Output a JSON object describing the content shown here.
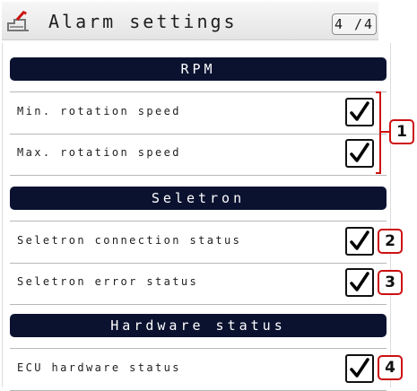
{
  "header": {
    "title": "Alarm settings",
    "page_indicator": "4 /4",
    "icon": "seeder-settings-icon"
  },
  "sections": [
    {
      "title": "RPM",
      "items": [
        {
          "label": "Min. rotation speed",
          "checked": true
        },
        {
          "label": "Max. rotation speed",
          "checked": true
        }
      ]
    },
    {
      "title": "Seletron",
      "items": [
        {
          "label": "Seletron connection status",
          "checked": true
        },
        {
          "label": "Seletron error status",
          "checked": true
        }
      ]
    },
    {
      "title": "Hardware status",
      "items": [
        {
          "label": "ECU hardware status",
          "checked": true
        }
      ]
    }
  ],
  "callouts": [
    "1",
    "2",
    "3",
    "4"
  ],
  "colors": {
    "section_bar": "#0b1230",
    "callout_border": "#cc1111"
  }
}
